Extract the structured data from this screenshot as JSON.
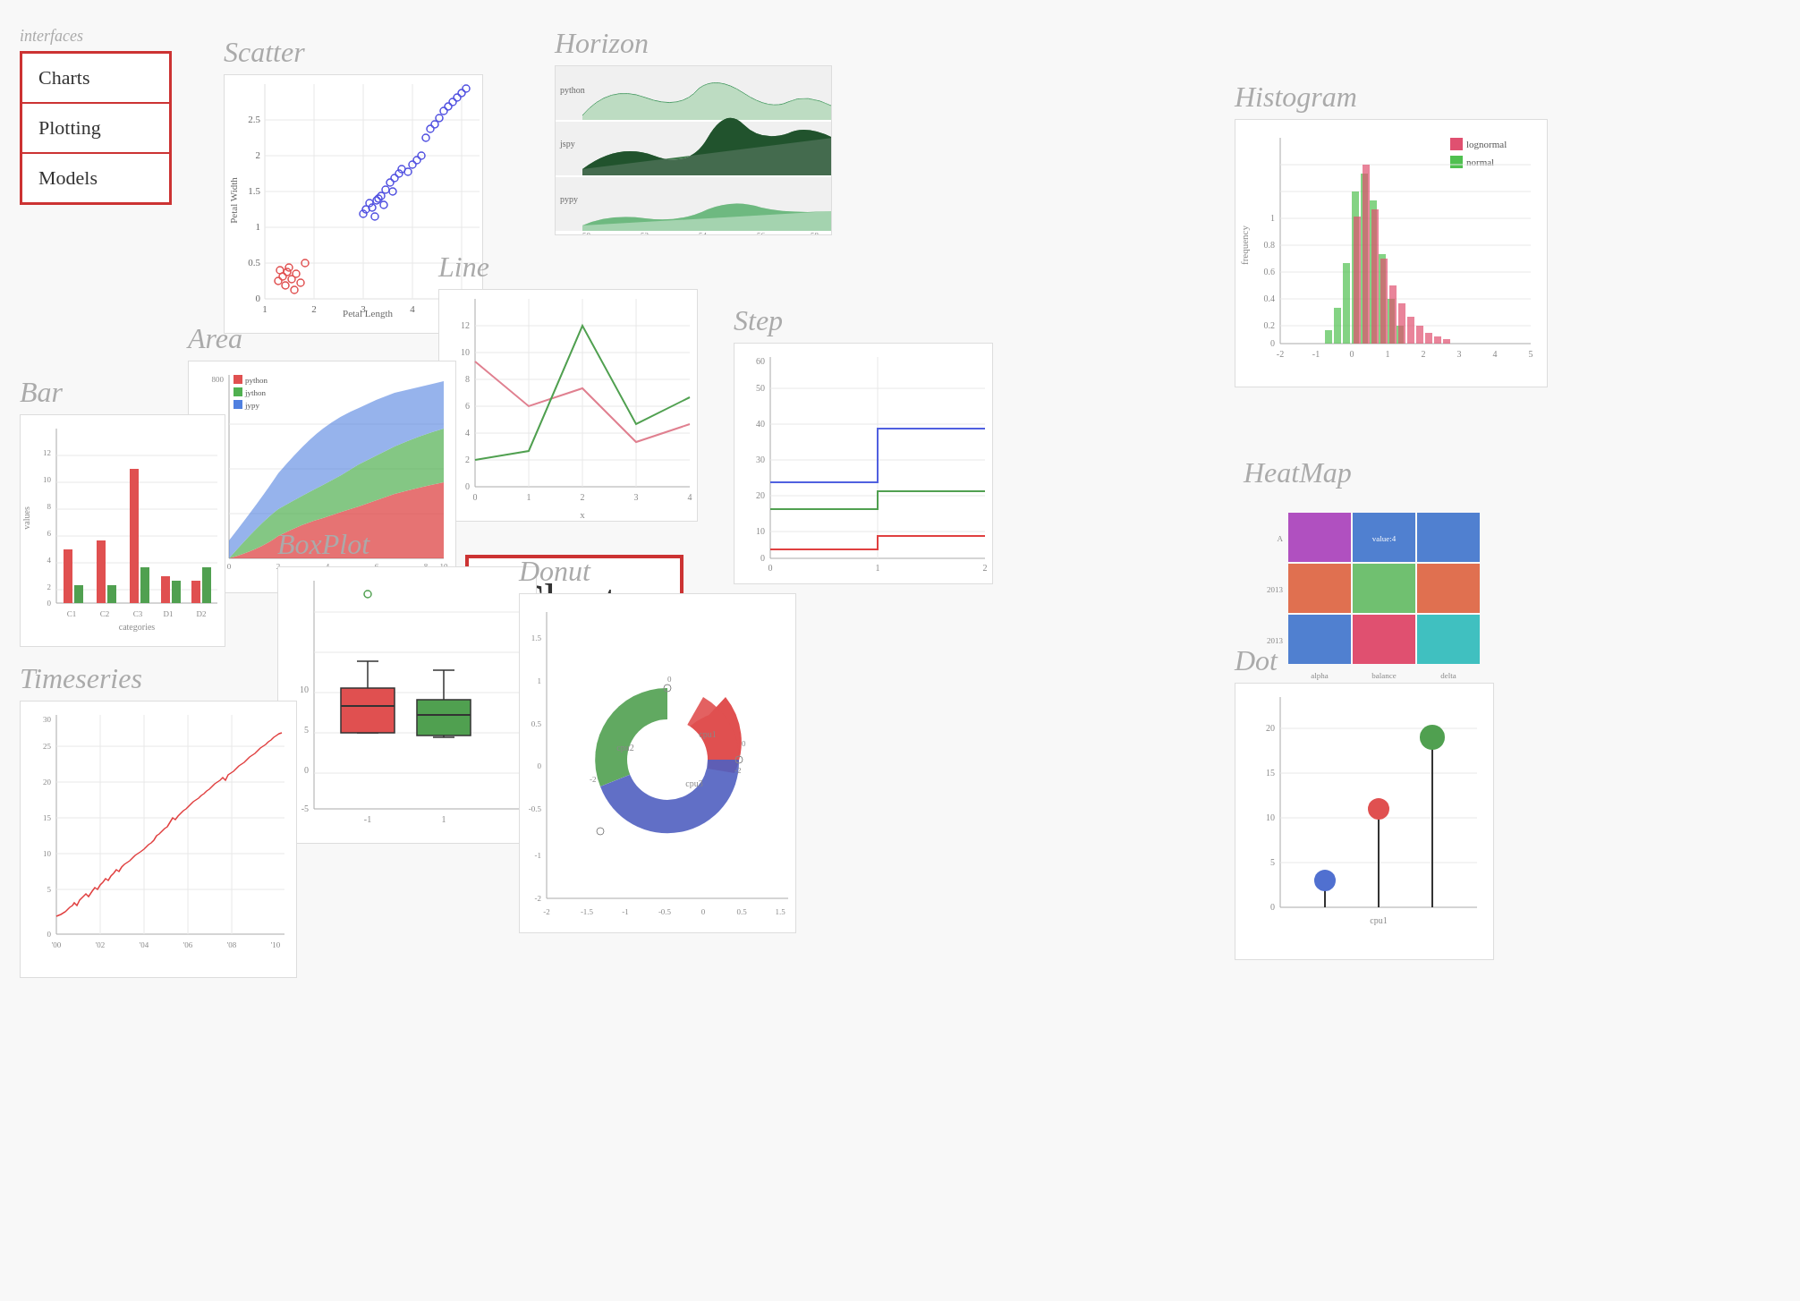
{
  "sidebar": {
    "label": "interfaces",
    "items": [
      {
        "label": "Charts",
        "active": true
      },
      {
        "label": "Plotting",
        "active": false
      },
      {
        "label": "Models",
        "active": false
      }
    ]
  },
  "charts_badge": {
    "label": "Charts"
  },
  "sections": {
    "scatter": {
      "title": "Scatter"
    },
    "horizon": {
      "title": "Horizon"
    },
    "histogram": {
      "title": "Histogram"
    },
    "line": {
      "title": "Line"
    },
    "area": {
      "title": "Area"
    },
    "step": {
      "title": "Step"
    },
    "bar": {
      "title": "Bar"
    },
    "boxplot": {
      "title": "BoxPlot"
    },
    "heatmap": {
      "title": "HeatMap"
    },
    "donut": {
      "title": "Donut"
    },
    "dot": {
      "title": "Dot"
    },
    "timeseries": {
      "title": "Timeseries"
    }
  }
}
